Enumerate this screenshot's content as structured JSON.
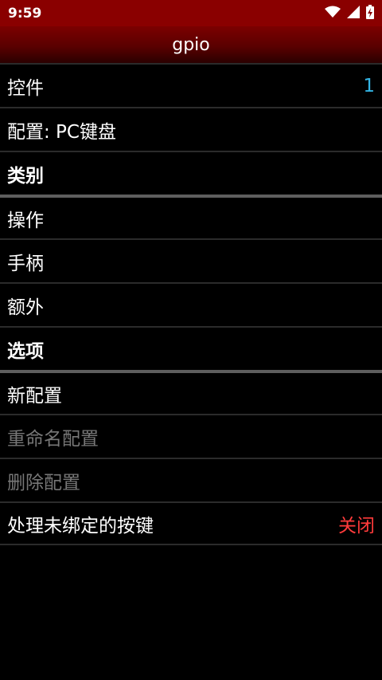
{
  "status": {
    "time": "9:59"
  },
  "app": {
    "title": "gpio"
  },
  "list": [
    {
      "label": "控件",
      "value": "1"
    },
    {
      "label": "配置: PC键盘"
    },
    {
      "label": "类别"
    },
    {
      "label": "操作"
    },
    {
      "label": "手柄"
    },
    {
      "label": "额外"
    },
    {
      "label": "选项"
    },
    {
      "label": "新配置"
    },
    {
      "label": "重命名配置"
    },
    {
      "label": "删除配置"
    },
    {
      "label": "处理未绑定的按键",
      "value": "关闭"
    }
  ],
  "colors": {
    "accent_blue": "#33b5e5",
    "accent_red": "#ff3b3b",
    "statusbar": "#8a0000"
  },
  "icons": [
    "wifi-icon",
    "signal-icon",
    "battery-charging-icon"
  ]
}
